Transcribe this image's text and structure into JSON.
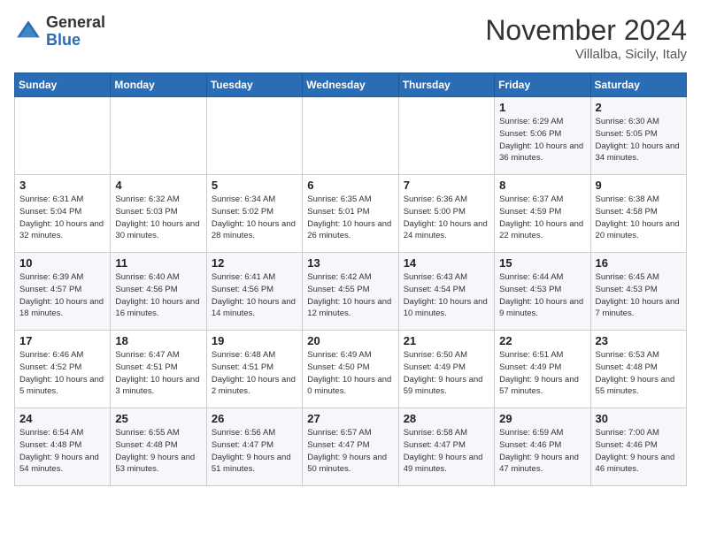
{
  "header": {
    "logo_general": "General",
    "logo_blue": "Blue",
    "month": "November 2024",
    "location": "Villalba, Sicily, Italy"
  },
  "days_of_week": [
    "Sunday",
    "Monday",
    "Tuesday",
    "Wednesday",
    "Thursday",
    "Friday",
    "Saturday"
  ],
  "weeks": [
    [
      {
        "day": "",
        "info": ""
      },
      {
        "day": "",
        "info": ""
      },
      {
        "day": "",
        "info": ""
      },
      {
        "day": "",
        "info": ""
      },
      {
        "day": "",
        "info": ""
      },
      {
        "day": "1",
        "info": "Sunrise: 6:29 AM\nSunset: 5:06 PM\nDaylight: 10 hours\nand 36 minutes."
      },
      {
        "day": "2",
        "info": "Sunrise: 6:30 AM\nSunset: 5:05 PM\nDaylight: 10 hours\nand 34 minutes."
      }
    ],
    [
      {
        "day": "3",
        "info": "Sunrise: 6:31 AM\nSunset: 5:04 PM\nDaylight: 10 hours\nand 32 minutes."
      },
      {
        "day": "4",
        "info": "Sunrise: 6:32 AM\nSunset: 5:03 PM\nDaylight: 10 hours\nand 30 minutes."
      },
      {
        "day": "5",
        "info": "Sunrise: 6:34 AM\nSunset: 5:02 PM\nDaylight: 10 hours\nand 28 minutes."
      },
      {
        "day": "6",
        "info": "Sunrise: 6:35 AM\nSunset: 5:01 PM\nDaylight: 10 hours\nand 26 minutes."
      },
      {
        "day": "7",
        "info": "Sunrise: 6:36 AM\nSunset: 5:00 PM\nDaylight: 10 hours\nand 24 minutes."
      },
      {
        "day": "8",
        "info": "Sunrise: 6:37 AM\nSunset: 4:59 PM\nDaylight: 10 hours\nand 22 minutes."
      },
      {
        "day": "9",
        "info": "Sunrise: 6:38 AM\nSunset: 4:58 PM\nDaylight: 10 hours\nand 20 minutes."
      }
    ],
    [
      {
        "day": "10",
        "info": "Sunrise: 6:39 AM\nSunset: 4:57 PM\nDaylight: 10 hours\nand 18 minutes."
      },
      {
        "day": "11",
        "info": "Sunrise: 6:40 AM\nSunset: 4:56 PM\nDaylight: 10 hours\nand 16 minutes."
      },
      {
        "day": "12",
        "info": "Sunrise: 6:41 AM\nSunset: 4:56 PM\nDaylight: 10 hours\nand 14 minutes."
      },
      {
        "day": "13",
        "info": "Sunrise: 6:42 AM\nSunset: 4:55 PM\nDaylight: 10 hours\nand 12 minutes."
      },
      {
        "day": "14",
        "info": "Sunrise: 6:43 AM\nSunset: 4:54 PM\nDaylight: 10 hours\nand 10 minutes."
      },
      {
        "day": "15",
        "info": "Sunrise: 6:44 AM\nSunset: 4:53 PM\nDaylight: 10 hours\nand 9 minutes."
      },
      {
        "day": "16",
        "info": "Sunrise: 6:45 AM\nSunset: 4:53 PM\nDaylight: 10 hours\nand 7 minutes."
      }
    ],
    [
      {
        "day": "17",
        "info": "Sunrise: 6:46 AM\nSunset: 4:52 PM\nDaylight: 10 hours\nand 5 minutes."
      },
      {
        "day": "18",
        "info": "Sunrise: 6:47 AM\nSunset: 4:51 PM\nDaylight: 10 hours\nand 3 minutes."
      },
      {
        "day": "19",
        "info": "Sunrise: 6:48 AM\nSunset: 4:51 PM\nDaylight: 10 hours\nand 2 minutes."
      },
      {
        "day": "20",
        "info": "Sunrise: 6:49 AM\nSunset: 4:50 PM\nDaylight: 10 hours\nand 0 minutes."
      },
      {
        "day": "21",
        "info": "Sunrise: 6:50 AM\nSunset: 4:49 PM\nDaylight: 9 hours\nand 59 minutes."
      },
      {
        "day": "22",
        "info": "Sunrise: 6:51 AM\nSunset: 4:49 PM\nDaylight: 9 hours\nand 57 minutes."
      },
      {
        "day": "23",
        "info": "Sunrise: 6:53 AM\nSunset: 4:48 PM\nDaylight: 9 hours\nand 55 minutes."
      }
    ],
    [
      {
        "day": "24",
        "info": "Sunrise: 6:54 AM\nSunset: 4:48 PM\nDaylight: 9 hours\nand 54 minutes."
      },
      {
        "day": "25",
        "info": "Sunrise: 6:55 AM\nSunset: 4:48 PM\nDaylight: 9 hours\nand 53 minutes."
      },
      {
        "day": "26",
        "info": "Sunrise: 6:56 AM\nSunset: 4:47 PM\nDaylight: 9 hours\nand 51 minutes."
      },
      {
        "day": "27",
        "info": "Sunrise: 6:57 AM\nSunset: 4:47 PM\nDaylight: 9 hours\nand 50 minutes."
      },
      {
        "day": "28",
        "info": "Sunrise: 6:58 AM\nSunset: 4:47 PM\nDaylight: 9 hours\nand 49 minutes."
      },
      {
        "day": "29",
        "info": "Sunrise: 6:59 AM\nSunset: 4:46 PM\nDaylight: 9 hours\nand 47 minutes."
      },
      {
        "day": "30",
        "info": "Sunrise: 7:00 AM\nSunset: 4:46 PM\nDaylight: 9 hours\nand 46 minutes."
      }
    ]
  ]
}
